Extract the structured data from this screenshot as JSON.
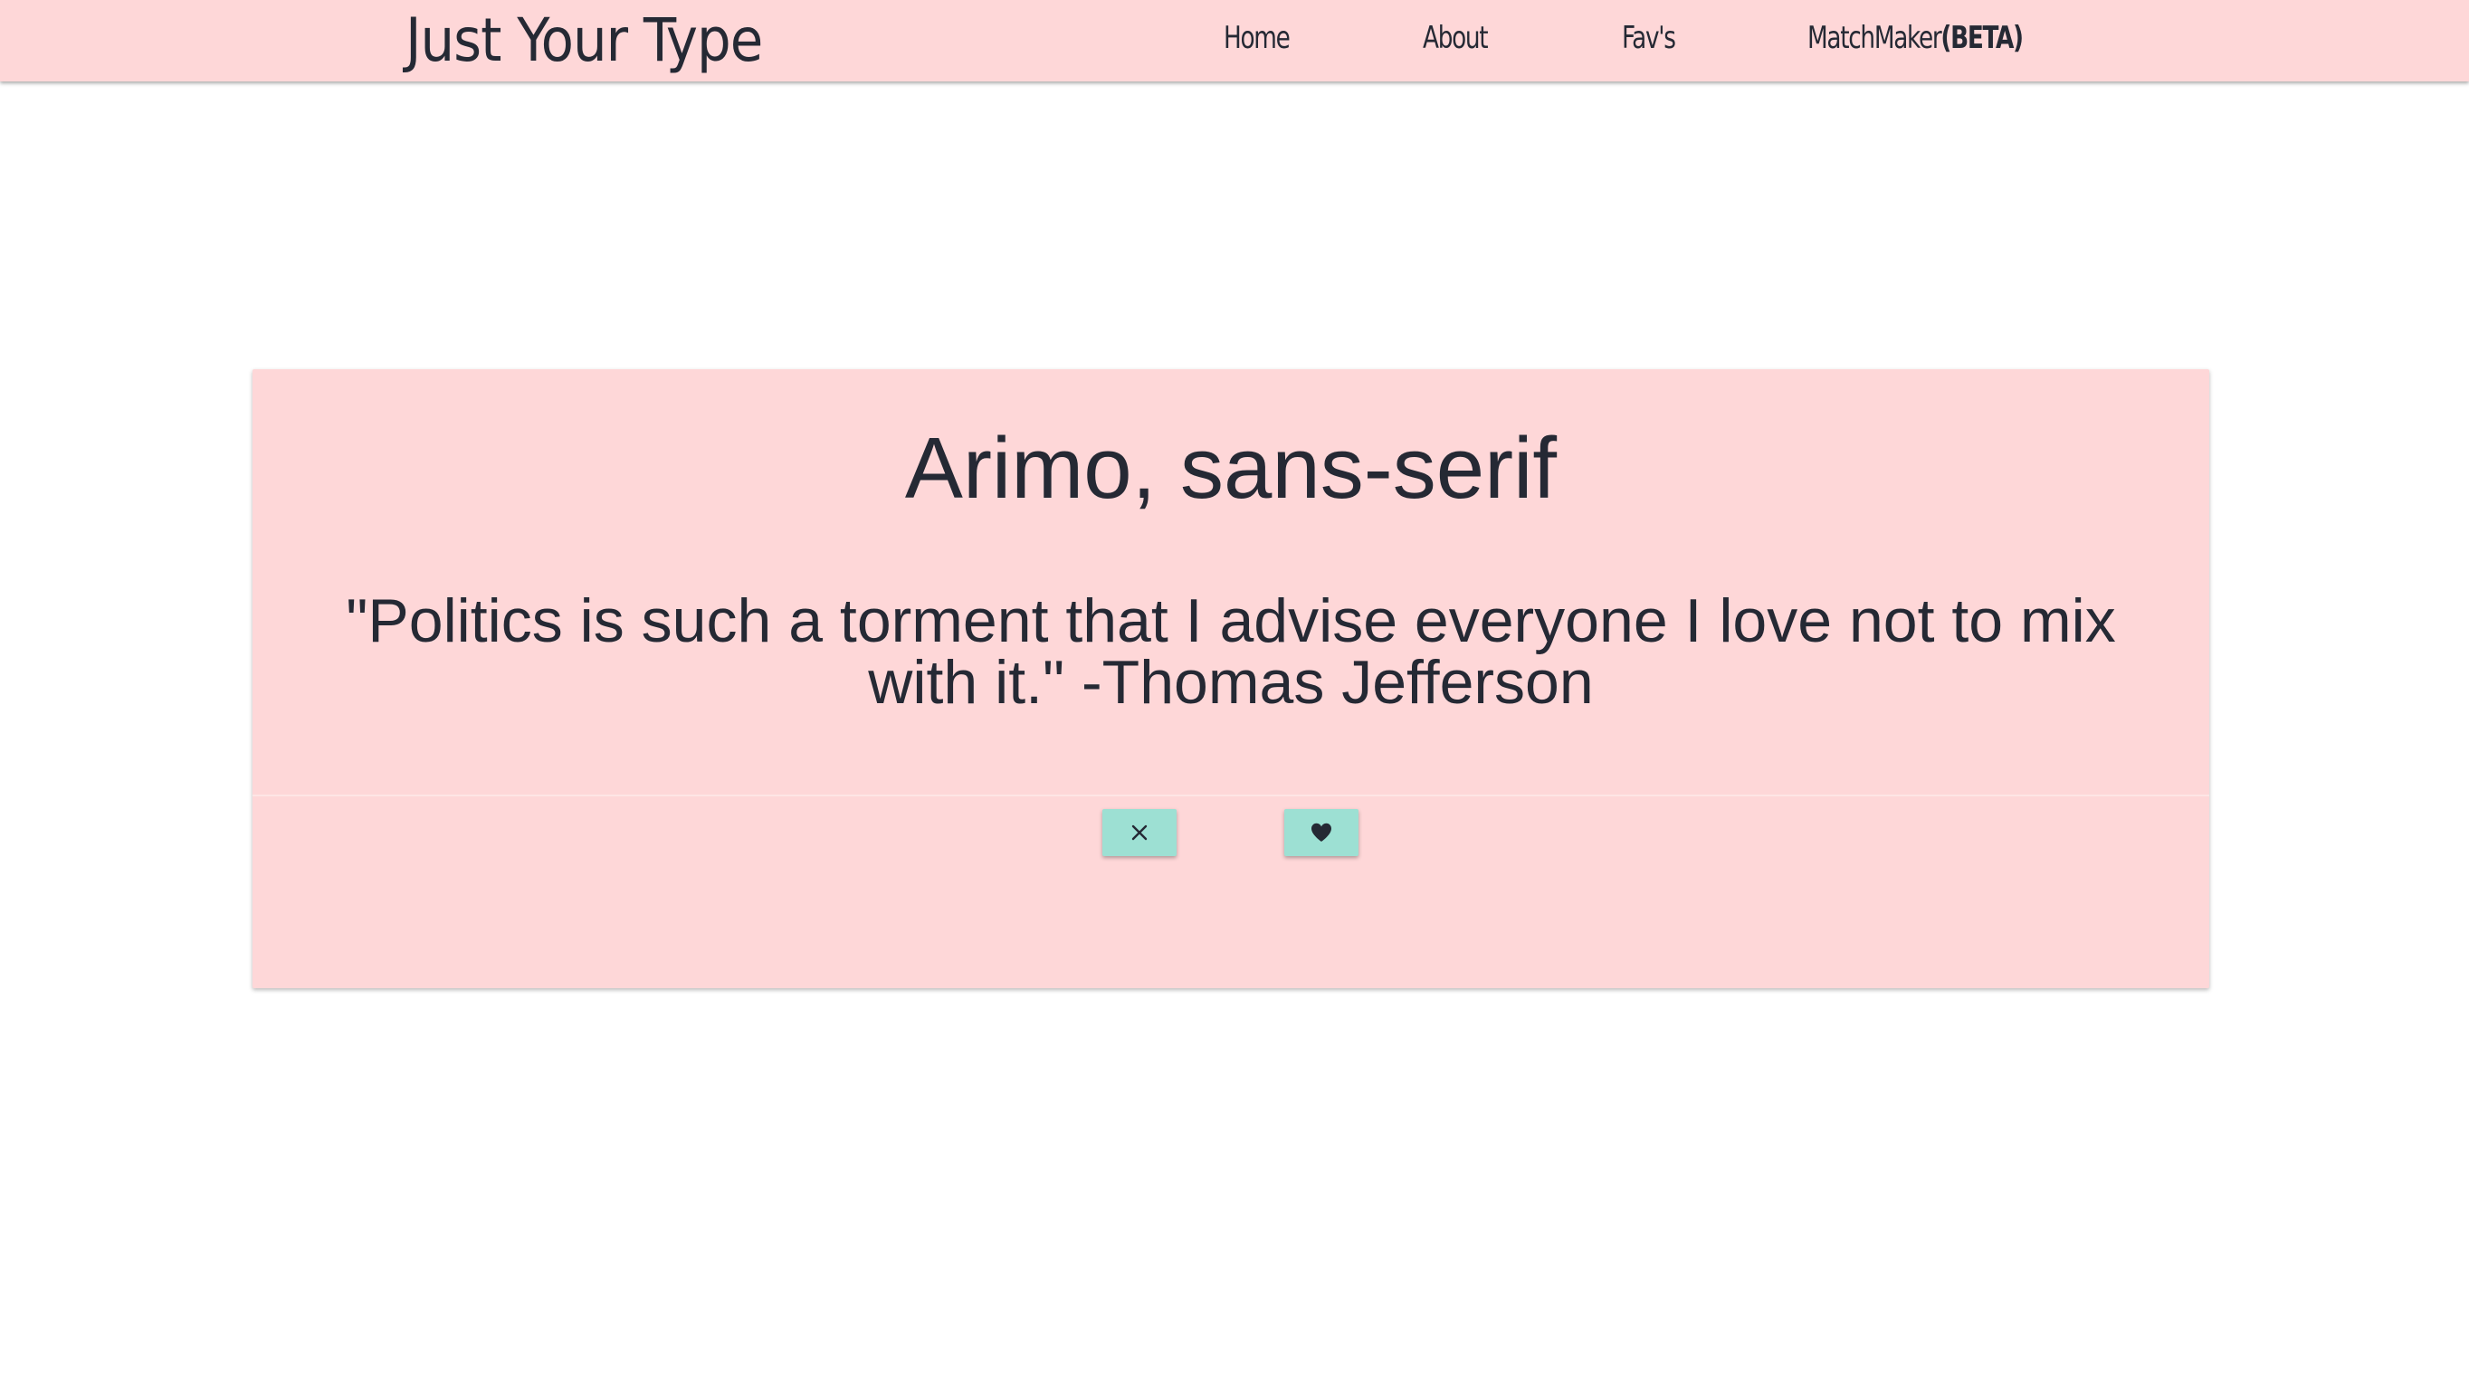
{
  "navbar": {
    "brand": "Just Your Type",
    "links": {
      "home": "Home",
      "about": "About",
      "favs": "Fav's",
      "matchmaker": "MatchMaker",
      "matchmaker_badge": "(BETA)"
    },
    "background_color": "#fed7d8"
  },
  "card": {
    "font_name": "Arimo, sans-serif",
    "quote": "\"Politics is such a torment that I advise everyone I love not to mix with it.\" -Thomas Jefferson",
    "background_color": "#fed7d8",
    "actions": {
      "reject_icon": "close-icon",
      "like_icon": "heart-icon",
      "button_color": "#9de0d3"
    }
  }
}
